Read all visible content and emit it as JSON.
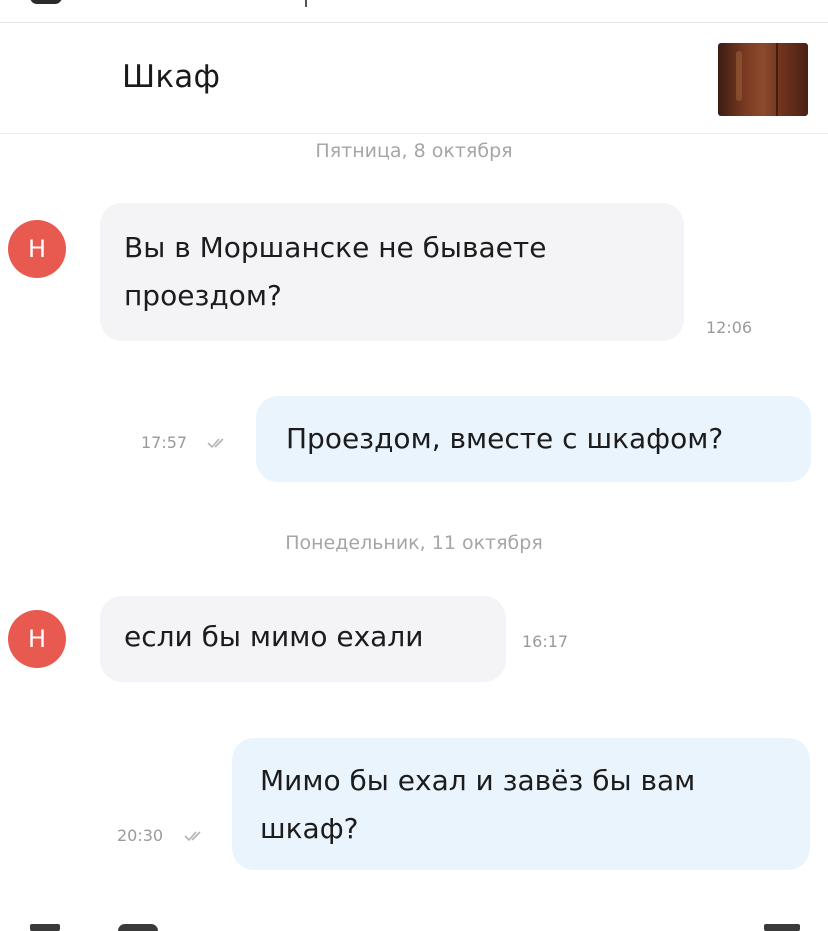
{
  "header": {
    "title": "Шкаф"
  },
  "messages": [
    {
      "type": "date",
      "text": "Пятница, 8 октября"
    },
    {
      "type": "incoming",
      "avatar_letter": "Н",
      "line1": "Вы в Моршанске не бываете",
      "line2": "проездом?",
      "time": "12:06"
    },
    {
      "type": "outgoing",
      "text": "Проездом, вместе с шкафом?",
      "time": "17:57",
      "status": "read"
    },
    {
      "type": "date",
      "text": "Понедельник, 11 октября"
    },
    {
      "type": "incoming",
      "avatar_letter": "Н",
      "text": "если бы мимо ехали",
      "time": "16:17"
    },
    {
      "type": "outgoing",
      "line1": "Мимо бы ехал и завёз бы вам",
      "line2": "шкаф?",
      "time": "20:30",
      "status": "read"
    }
  ],
  "colors": {
    "avatar_bg": "#e85a4f",
    "incoming_bubble": "#f4f4f6",
    "outgoing_bubble": "#eaf4fd",
    "meta_text": "#9a9a9a"
  },
  "icons": {
    "read_status": "double-check-icon"
  }
}
